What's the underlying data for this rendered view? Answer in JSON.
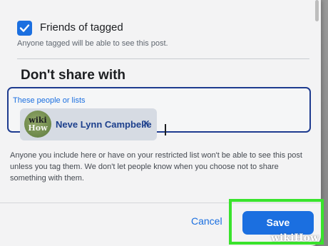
{
  "tagged_option": {
    "label": "Friends of tagged",
    "checked": true,
    "description": "Anyone tagged will be able to see this post."
  },
  "dont_share": {
    "title": "Don't share with",
    "field_label": "These people or lists",
    "selected_people": [
      {
        "name": "Neve Lynn Campbelle",
        "remove_symbol": "✕"
      }
    ],
    "note": "Anyone you include here or have on your restricted list won't be able to see this post unless you tag them. We don't let people know when you choose not to share something with them."
  },
  "footer": {
    "cancel_label": "Cancel",
    "save_label": "Save"
  },
  "watermark": {
    "text": "wikiHow"
  },
  "colors": {
    "accent": "#1b6fe0",
    "highlight": "#39e32c",
    "chip_text": "#1c3f8c"
  }
}
